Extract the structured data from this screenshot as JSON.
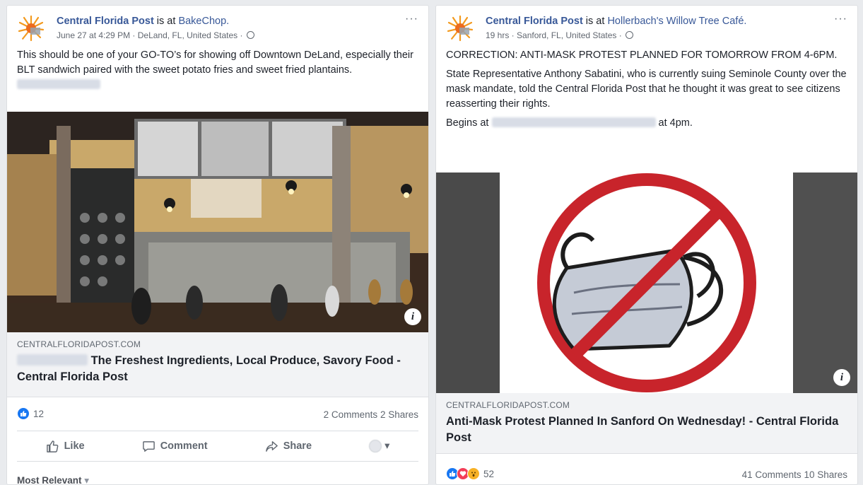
{
  "post1": {
    "page_name": "Central Florida Post",
    "is_at": " is at ",
    "place": "BakeChop.",
    "meta": "June 27 at 4:29 PM · DeLand, FL, United States · ",
    "text": "This should be one of your GO-TO’s for showing off Downtown DeLand, especially their BLT sandwich paired with the sweet potato fries and sweet fried plantains.",
    "domain": "CENTRALFLORIDAPOST.COM",
    "link_title": "The Freshest Ingredients, Local Produce, Savory Food - Central Florida Post",
    "reaction_count": "12",
    "comments": "2 Comments",
    "shares": "2 Shares",
    "like_label": "Like",
    "comment_label": "Comment",
    "share_label": "Share",
    "sort_label": "Most Relevant"
  },
  "post2": {
    "page_name": "Central Florida Post",
    "is_at": " is at ",
    "place": "Hollerbach's Willow Tree Café.",
    "meta": "19 hrs · Sanford, FL, United States · ",
    "text1": "CORRECTION: ANTI-MASK PROTEST PLANNED FOR TOMORROW FROM 4-6PM.",
    "text2": "State Representative Anthony Sabatini, who is currently suing Seminole County over the mask mandate, told the Central Florida Post that he thought it was great to see citizens reasserting their rights.",
    "text3_start": "Begins at",
    "text3_end": "at 4pm.",
    "domain": "CENTRALFLORIDAPOST.COM",
    "link_title": "Anti-Mask Protest Planned In Sanford On Wednesday! - Central Florida Post",
    "reaction_count": "52",
    "comments": "41 Comments",
    "shares": "10 Shares"
  },
  "icons": {
    "more": "···",
    "info": "i",
    "caret": "▾"
  },
  "colors": {
    "link": "#385898",
    "like_blue": "#1877f2",
    "love_red": "#f33e58",
    "wow_yellow": "#f7b125",
    "prohibition_red": "#c8242b"
  }
}
